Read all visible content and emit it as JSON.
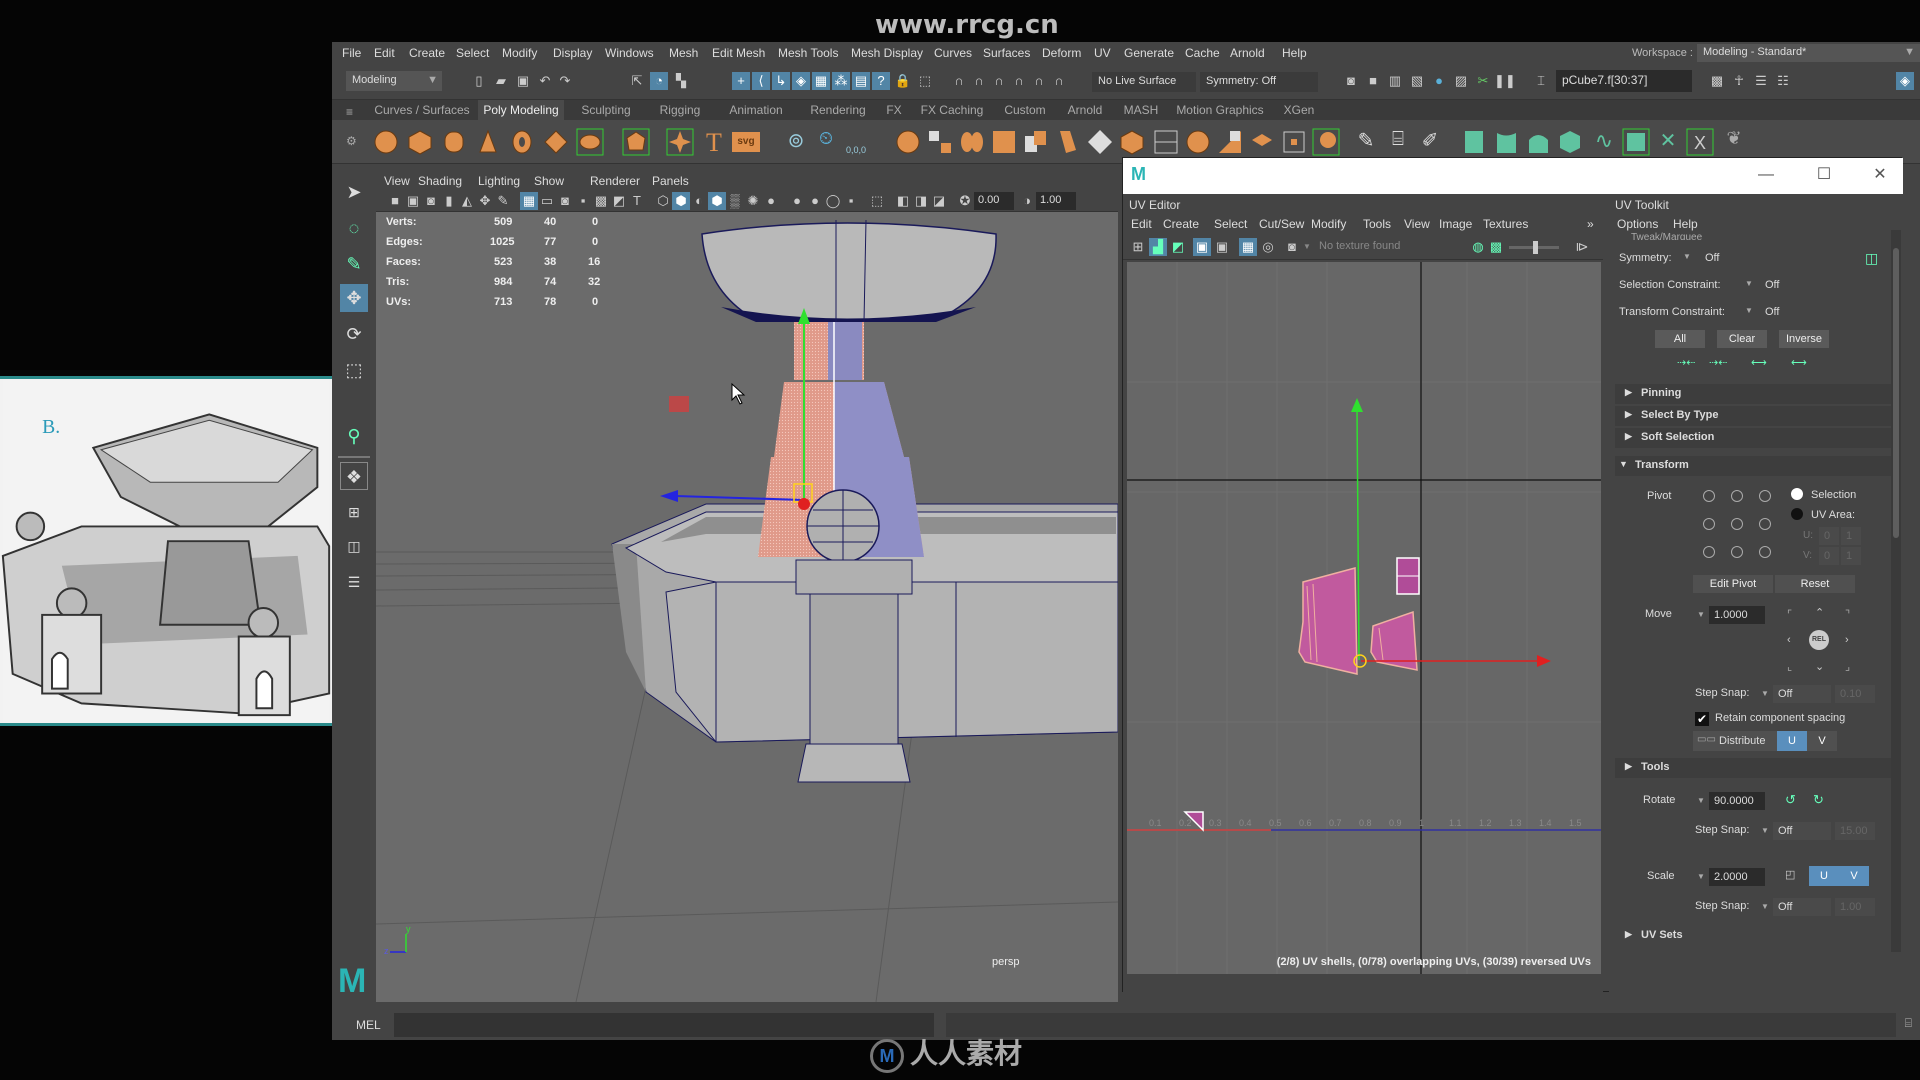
{
  "overlay": {
    "top_watermark": "www.rrcg.cn",
    "bottom_watermark": "人人素材"
  },
  "menubar": {
    "items": [
      "File",
      "Edit",
      "Create",
      "Select",
      "Modify",
      "Display",
      "Windows",
      "Mesh",
      "Edit Mesh",
      "Mesh Tools",
      "Mesh Display",
      "Curves",
      "Surfaces",
      "Deform",
      "UV",
      "Generate",
      "Cache",
      "Arnold",
      "Help"
    ],
    "workspace_label": "Workspace :",
    "workspace_value": "Modeling - Standard*"
  },
  "statusline": {
    "mode": "Modeling",
    "live_surface": "No Live Surface",
    "symmetry": "Symmetry: Off",
    "selection_field": "pCube7.f[30:37]"
  },
  "shelf": {
    "tabs": [
      "Curves / Surfaces",
      "Poly Modeling",
      "Sculpting",
      "Rigging",
      "Animation",
      "Rendering",
      "FX",
      "FX Caching",
      "Custom",
      "Arnold",
      "MASH",
      "Motion Graphics",
      "XGen"
    ],
    "active_tab": "Poly Modeling",
    "svg_label": "svg",
    "coords_label": "0,0,0"
  },
  "viewport": {
    "menu": [
      "View",
      "Shading",
      "Lighting",
      "Show",
      "Renderer",
      "Panels"
    ],
    "exposure": "0.00",
    "gamma": "1.00",
    "camera_label": "persp",
    "hud": [
      {
        "label": "Verts:",
        "total": "509",
        "selected": "40",
        "uv": "0"
      },
      {
        "label": "Edges:",
        "total": "1025",
        "selected": "77",
        "uv": "0"
      },
      {
        "label": "Faces:",
        "total": "523",
        "selected": "38",
        "uv": "16"
      },
      {
        "label": "Tris:",
        "total": "984",
        "selected": "74",
        "uv": "32"
      },
      {
        "label": "UVs:",
        "total": "713",
        "selected": "78",
        "uv": "0"
      }
    ]
  },
  "command_line": {
    "label": "MEL"
  },
  "uv_window": {
    "logo": "M",
    "minimize": "—",
    "maximize": "☐",
    "close": "✕"
  },
  "uv_editor": {
    "title": "UV Editor",
    "menu": [
      "Edit",
      "Create",
      "Select",
      "Cut/Sew",
      "Modify",
      "Tools",
      "View",
      "Image",
      "Textures"
    ],
    "more": "»",
    "texture_status": "No texture found",
    "axis_ticks": [
      "0.1",
      "0.2",
      "0.3",
      "0.4",
      "0.5",
      "0.6",
      "0.7",
      "0.8",
      "0.9",
      "1",
      "1.1",
      "1.2",
      "1.3",
      "1.4",
      "1.5"
    ],
    "status": "(2/8) UV shells, (0/78) overlapping UVs, (30/39) reversed UVs"
  },
  "uv_toolkit": {
    "title": "UV Toolkit",
    "menu": [
      "Options",
      "Help"
    ],
    "partial_header": "Tweak/Marquee",
    "symmetry_label": "Symmetry:",
    "symmetry_value": "Off",
    "selection_constraint_label": "Selection Constraint:",
    "selection_constraint_value": "Off",
    "transform_constraint_label": "Transform Constraint:",
    "transform_constraint_value": "Off",
    "buttons": [
      "All",
      "Clear",
      "Inverse"
    ],
    "sections": {
      "pinning": "Pinning",
      "select_by_type": "Select By Type",
      "soft_selection": "Soft Selection",
      "transform": "Transform",
      "tools": "Tools",
      "uv_sets": "UV Sets"
    },
    "pivot": {
      "label": "Pivot",
      "selection": "Selection",
      "uv_area": "UV Area:",
      "u_label": "U:",
      "v_label": "V:",
      "u_min": "0",
      "u_max": "1",
      "v_min": "0",
      "v_max": "1",
      "edit_pivot": "Edit Pivot",
      "reset": "Reset"
    },
    "move": {
      "label": "Move",
      "value": "1.0000",
      "rel": "REL",
      "step_snap_label": "Step Snap:",
      "step_snap_value": "Off",
      "step_snap_amount": "0.10",
      "retain_label": "Retain component spacing",
      "retain_checked": true,
      "distribute_label": "Distribute",
      "u": "U",
      "v": "V"
    },
    "rotate": {
      "label": "Rotate",
      "value": "90.0000",
      "step_snap_label": "Step Snap:",
      "step_snap_value": "Off",
      "step_snap_amount": "15.00"
    },
    "scale": {
      "label": "Scale",
      "value": "2.0000",
      "u": "U",
      "v": "V",
      "step_snap_label": "Step Snap:",
      "step_snap_value": "Off",
      "step_snap_amount": "1.00"
    }
  },
  "reference_image": {
    "annotation": "B."
  },
  "colors": {
    "accent_blue": "#5285a6",
    "selection_pink": "#c15a9e",
    "maya_teal": "#2bb5b5",
    "axis_x": "#e02020",
    "axis_y": "#20e020",
    "axis_z": "#2020e0"
  }
}
